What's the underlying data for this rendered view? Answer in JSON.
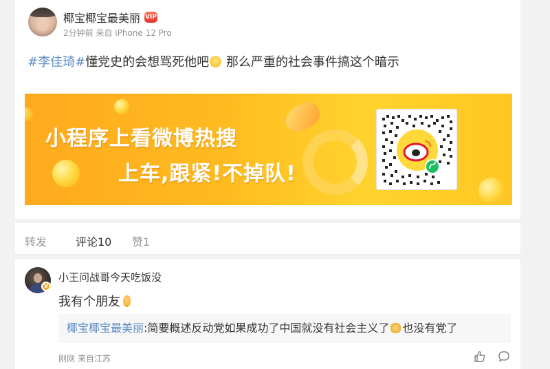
{
  "post": {
    "username": "椰宝椰宝最美丽",
    "vip_badge": "VIP",
    "meta": "2分钟前 来自 iPhone 12 Pro",
    "topic": "#李佳琦#",
    "text_part1": "懂党史的会想骂死他吧",
    "text_part2": " 那么严重的社会事件搞这个暗示"
  },
  "banner": {
    "line1": "小程序上看微博热搜",
    "line2": "上车,跟紧!不掉队!"
  },
  "tabs": [
    {
      "label": "转发",
      "active": false
    },
    {
      "label": "评论10",
      "active": true
    },
    {
      "label": "赞1",
      "active": false
    }
  ],
  "comment": {
    "username": "小王问战哥今天吃饭没",
    "text": "我有个朋友",
    "reply_user": "椰宝椰宝最美丽",
    "reply_text_1": ":简要概述反动党如果成功了中国就没有社会主义了",
    "reply_text_2": "也没有党了",
    "meta": "刚刚 来自江苏",
    "verified_badge": "V"
  },
  "colors": {
    "link_blue": "#5d8dc4",
    "topic_orange": "#eb7350",
    "banner_orange": "#ffaa1e",
    "meta_gray": "#939393"
  },
  "icons": {
    "like": "thumbs-up-icon",
    "comment": "speech-bubble-icon",
    "emoji_smile": "smile-emoji-icon",
    "emoji_ear": "ear-emoji-icon",
    "emoji_cat": "cat-emoji-icon",
    "weibo_logo": "weibo-logo-icon",
    "mini_program": "mini-program-icon"
  }
}
